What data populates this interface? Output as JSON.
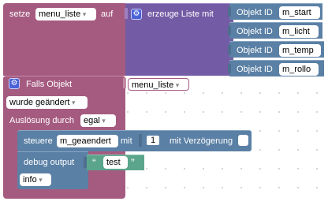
{
  "set_block": {
    "prefix": "setze",
    "variable": "menu_liste",
    "suffix": "auf"
  },
  "list_block": {
    "label": "erzeuge Liste mit",
    "items": [
      {
        "label": "Objekt ID",
        "value": "m_start"
      },
      {
        "label": "Objekt ID",
        "value": "m_licht"
      },
      {
        "label": "Objekt ID",
        "value": "m_temp"
      },
      {
        "label": "Objekt ID",
        "value": "m_rollo"
      }
    ]
  },
  "trigger_block": {
    "label": "Falls Objekt",
    "object": "menu_liste",
    "event": "wurde geändert",
    "trigger_label": "Auslösung durch",
    "trigger_value": "egal"
  },
  "control_block": {
    "label": "steuere",
    "target": "m_geaendert",
    "with_label": "mit",
    "value": "1",
    "delay_label": "mit Verzögerung"
  },
  "debug_block": {
    "label": "debug output",
    "open_quote": "“",
    "text": "test",
    "close_quote": "”",
    "level": "info"
  },
  "colors": {
    "variables": "#a55b80",
    "lists": "#745ba5",
    "objects": "#5b80a5",
    "text": "#5ba58c",
    "gear": "#4a62d6"
  },
  "icons": {
    "mutator": "gear-icon"
  }
}
